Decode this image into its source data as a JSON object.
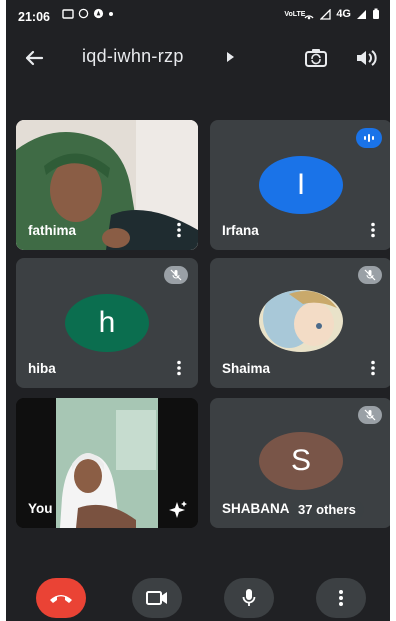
{
  "status_bar": {
    "time": "21:06",
    "network": "4G",
    "volte": "VoLTE"
  },
  "header": {
    "meeting_code": "iqd-iwhn-rzp"
  },
  "participants": [
    {
      "name": "fathima",
      "kind": "video"
    },
    {
      "name": "Irfana",
      "kind": "avatar",
      "initial": "I",
      "avatar_color": "#1a73e8",
      "speaking": true
    },
    {
      "name": "hiba",
      "kind": "avatar",
      "initial": "h",
      "avatar_color": "#0b6e4f",
      "muted": true
    },
    {
      "name": "Shaima",
      "kind": "photo-avatar",
      "muted": true
    },
    {
      "name": "You",
      "kind": "self-video"
    },
    {
      "name": "SHABANA",
      "kind": "avatar",
      "initial": "S",
      "avatar_color": "#795548",
      "muted": true
    }
  ],
  "others_count_label": "37 others",
  "colors": {
    "background": "#202124",
    "tile": "#3c4043",
    "end_call": "#ea4335"
  },
  "controls": [
    "end-call",
    "camera",
    "microphone",
    "more-options"
  ]
}
